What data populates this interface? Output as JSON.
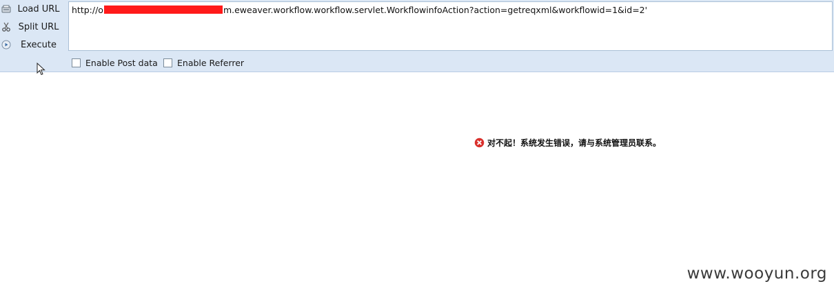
{
  "hackbar": {
    "load_url_label": "Load URL",
    "split_url_label": "Split URL",
    "execute_label": "Execute",
    "url_prefix": "http://o",
    "url_suffix": "m.eweaver.workflow.workflow.servlet.WorkflowinfoAction?action=getreqxml&workflowid=1&id=2'",
    "enable_post_label": "Enable Post data",
    "enable_referrer_label": "Enable Referrer",
    "enable_post_checked": false,
    "enable_referrer_checked": false
  },
  "page": {
    "error_message": "对不起！系统发生错误，请与系统管理员联系。"
  },
  "watermark": "www.wooyun.org",
  "icons": {
    "load": "load-url-icon",
    "split": "scissors-icon",
    "execute": "play-icon",
    "error": "error-icon",
    "cursor": "mouse-cursor-icon"
  },
  "colors": {
    "toolbar_bg": "#dbe7f5",
    "redaction": "#ff1a1a",
    "error_icon": "#d9302c"
  }
}
